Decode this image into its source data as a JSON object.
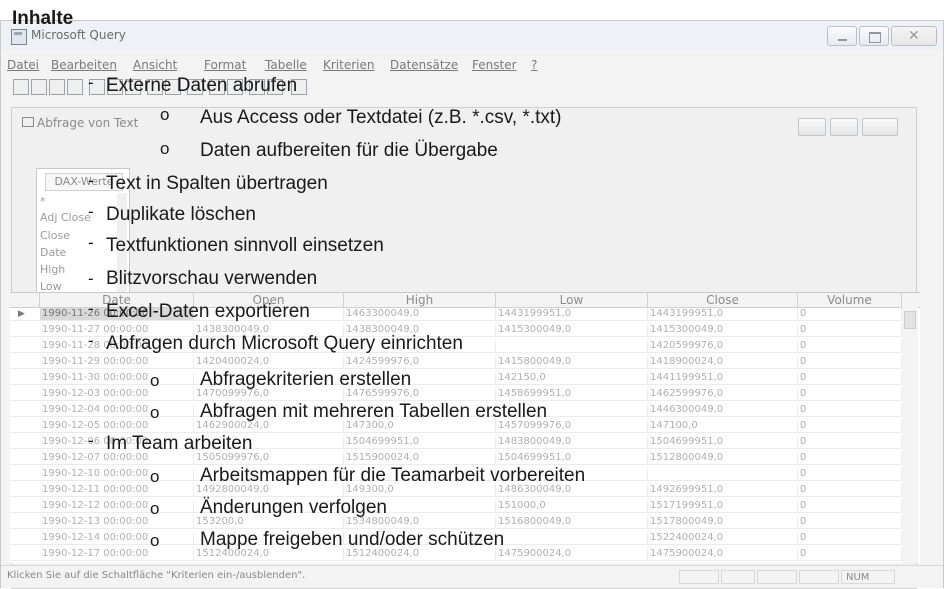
{
  "slide": {
    "heading": "Inhalte",
    "items": [
      {
        "bullet": "-",
        "text": "Externe Daten abrufen"
      },
      {
        "bullet": "o",
        "text": "Aus Access oder Textdatei (z.B. *.csv, *.txt)"
      },
      {
        "bullet": "o",
        "text": "Daten aufbereiten für die Übergabe"
      },
      {
        "bullet": "-",
        "text": "Text in Spalten übertragen"
      },
      {
        "bullet": "-",
        "text": "Duplikate löschen"
      },
      {
        "bullet": "-",
        "text": "Textfunktionen sinnvoll einsetzen"
      },
      {
        "bullet": "-",
        "text": "Blitzvorschau verwenden"
      },
      {
        "bullet": "-",
        "text": "Excel-Daten exportieren"
      },
      {
        "bullet": "-",
        "text": "Abfragen durch Microsoft Query einrichten"
      },
      {
        "bullet": "o",
        "text": "Abfragekriterien erstellen"
      },
      {
        "bullet": "o",
        "text": "Abfragen mit mehreren Tabellen erstellen"
      },
      {
        "bullet": "-",
        "text": "Im Team arbeiten"
      },
      {
        "bullet": "o",
        "text": "Arbeitsmappen für die Teamarbeit vorbereiten"
      },
      {
        "bullet": "o",
        "text": "Änderungen verfolgen"
      },
      {
        "bullet": "o",
        "text": "Mappe freigeben und/oder schützen"
      }
    ]
  },
  "window": {
    "title": "Microsoft Query",
    "menu": [
      "Datei",
      "Bearbeiten",
      "Ansicht",
      "Format",
      "Tabelle",
      "Kriterien",
      "Datensätze",
      "Fenster",
      "?"
    ],
    "subwindow_title": "Abfrage von Text",
    "table_box": {
      "title": "DAX-Werte",
      "fields": [
        "*",
        "Adj Close",
        "Close",
        "Date",
        "High",
        "Low"
      ]
    },
    "columns": [
      "Date",
      "Open",
      "High",
      "Low",
      "Close",
      "Volume"
    ],
    "rows": [
      [
        "1990-11-26 00:00:00",
        "",
        "1463300049,0",
        "1443199951,0",
        "1443199951,0",
        "0"
      ],
      [
        "1990-11-27 00:00:00",
        "1438300049,0",
        "1438300049,0",
        "1415300049,0",
        "1415300049,0",
        "0"
      ],
      [
        "1990-11-28 00:00:00",
        "",
        "",
        "",
        "1420599976,0",
        "0"
      ],
      [
        "1990-11-29 00:00:00",
        "1420400024,0",
        "1424599976,0",
        "1415800049,0",
        "1418900024,0",
        "0"
      ],
      [
        "1990-11-30 00:00:00",
        "",
        "",
        "142150,0",
        "1441199951,0",
        "0"
      ],
      [
        "1990-12-03 00:00:00",
        "1470099976,0",
        "1476599976,0",
        "1458699951,0",
        "1462599976,0",
        "0"
      ],
      [
        "1990-12-04 00:00:00",
        "",
        "",
        "",
        "1446300049,0",
        "0"
      ],
      [
        "1990-12-05 00:00:00",
        "1462900024,0",
        "147300,0",
        "1457099976,0",
        "147100,0",
        "0"
      ],
      [
        "1990-12-06 00:00:00",
        "",
        "1504699951,0",
        "1483800049,0",
        "1504699951,0",
        "0"
      ],
      [
        "1990-12-07 00:00:00",
        "1505099976,0",
        "1515900024,0",
        "1504699951,0",
        "1512800049,0",
        "0"
      ],
      [
        "1990-12-10 00:00:00",
        "",
        "",
        "",
        "",
        "0"
      ],
      [
        "1990-12-11 00:00:00",
        "1492800049,0",
        "149300,0",
        "1486300049,0",
        "1492699951,0",
        "0"
      ],
      [
        "1990-12-12 00:00:00",
        "",
        "",
        "151000,0",
        "1517199951,0",
        "0"
      ],
      [
        "1990-12-13 00:00:00",
        "153200,0",
        "1534800049,0",
        "1516800049,0",
        "1517800049,0",
        "0"
      ],
      [
        "1990-12-14 00:00:00",
        "",
        "",
        "",
        "1522400024,0",
        "0"
      ],
      [
        "1990-12-17 00:00:00",
        "1512400024,0",
        "1512400024,0",
        "1475900024,0",
        "1475900024,0",
        "0"
      ]
    ],
    "status": "Klicken Sie auf die Schaltfläche \"Kriterien ein-/ausblenden\".",
    "status_num": "NUM"
  }
}
